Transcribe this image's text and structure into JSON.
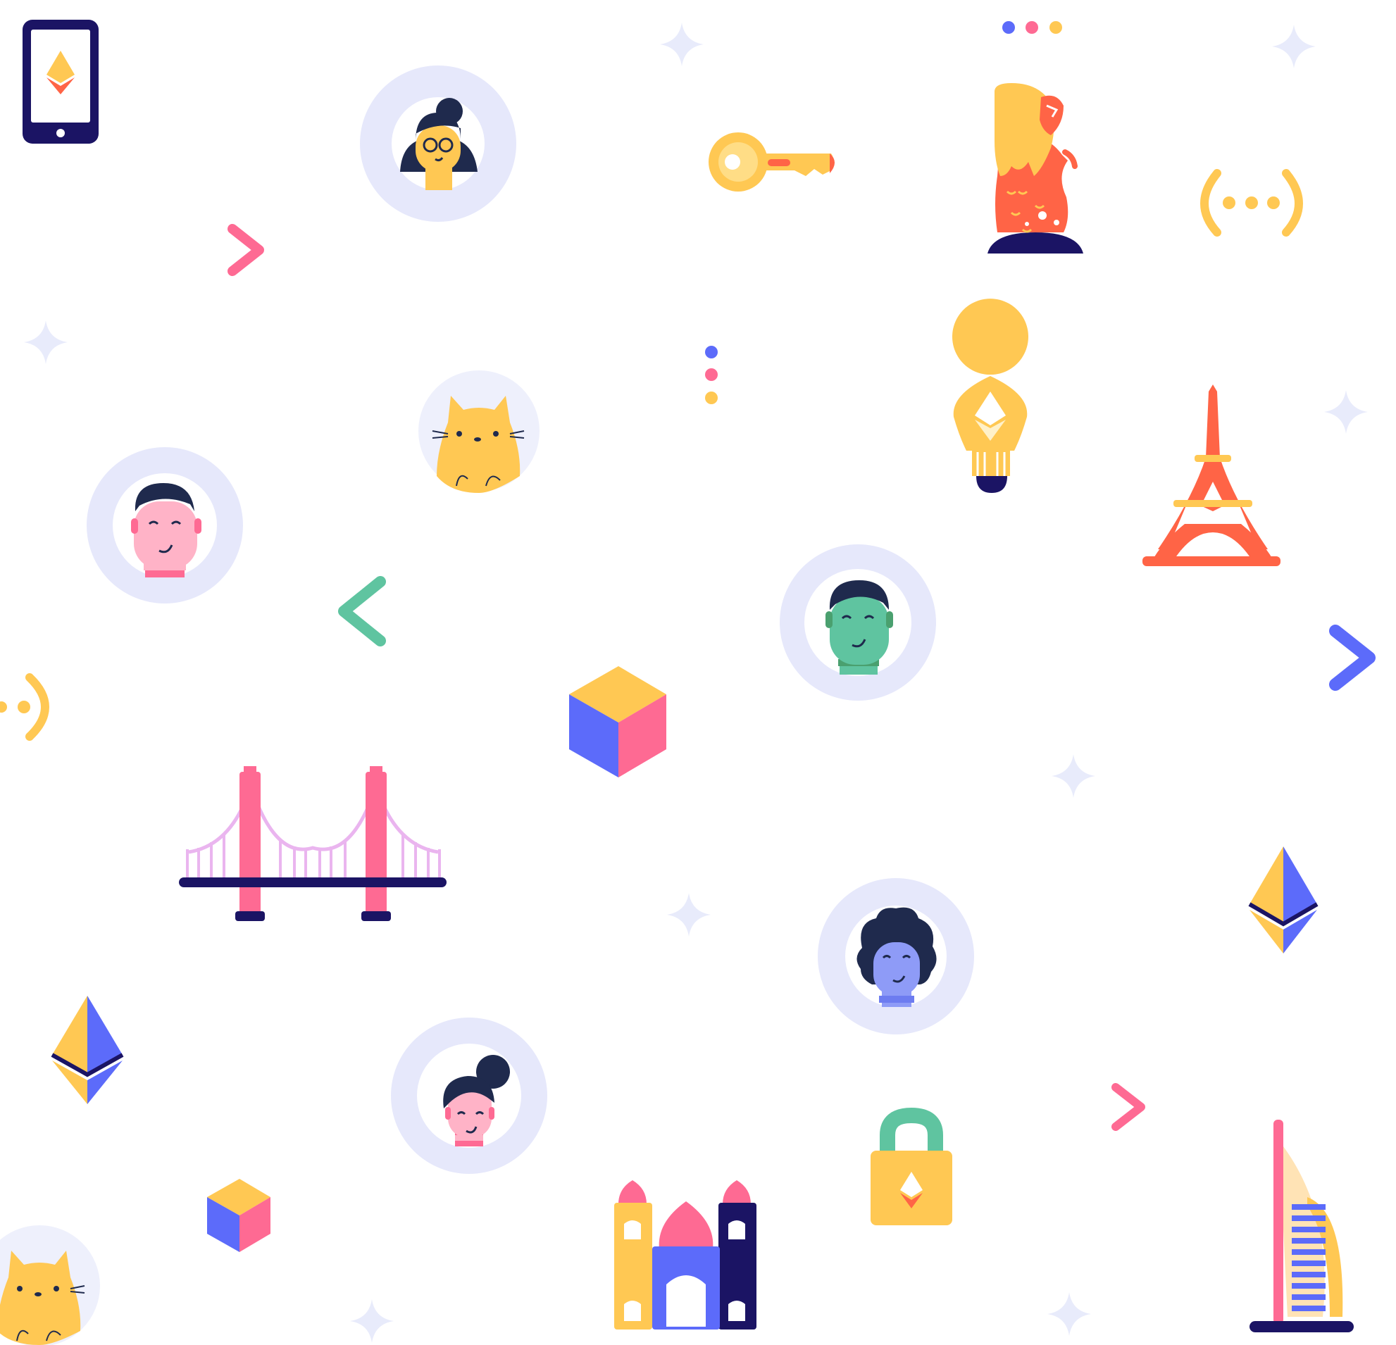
{
  "palette": {
    "background": "#ffffff",
    "navy": "#1b1464",
    "navy_dark": "#1f2a4d",
    "pink": "#fe6a93",
    "yellow": "#ffc853",
    "blue": "#5c6bfa",
    "green": "#5fc4a0",
    "orange": "#ff6446",
    "lilac": "#e6e8fb",
    "sparkle": "#e8ebfb",
    "bridge_cable": "#eab5ef"
  },
  "icons": [
    "phone-ethereum-icon",
    "woman-glasses-avatar",
    "key-icon",
    "merlion-icon",
    "signal-brackets-icon",
    "chevron-right-pink-icon",
    "cat-avatar",
    "lightbulb-ethereum-icon",
    "eiffel-tower-icon",
    "man-pink-avatar",
    "chevron-left-green-icon",
    "man-green-avatar",
    "chevron-right-blue-icon",
    "signal-partial-icon",
    "cube-large-icon",
    "golden-gate-bridge-icon",
    "ethereum-logo-icon",
    "curly-hair-avatar",
    "woman-bun-avatar",
    "padlock-ethereum-icon",
    "cube-small-icon",
    "taj-mahal-icon",
    "burj-al-arab-icon",
    "sparkle-icon",
    "dots-icon"
  ]
}
